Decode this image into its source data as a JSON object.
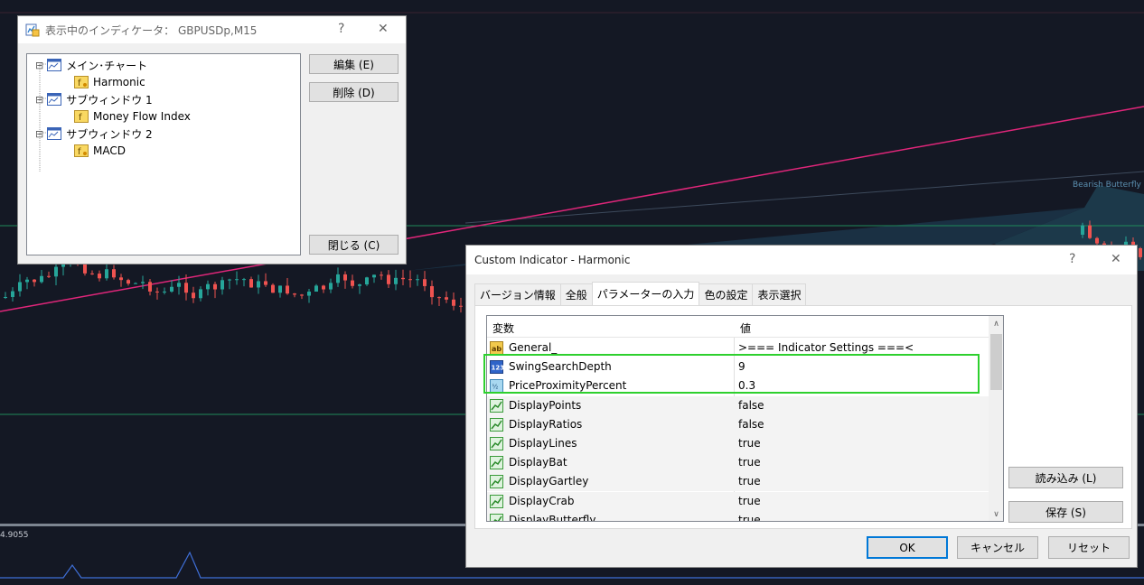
{
  "chart": {
    "price_label": "4.9055",
    "annotation": "Bearish Butterfly",
    "colors": {
      "background": "#141824",
      "bull_candle": "#26a69a",
      "bear_candle": "#ef5350",
      "trendline": "#e0267a",
      "hline": "#1f8a5a"
    }
  },
  "indicators_window": {
    "title": "表示中のインディケータ：  GBPUSDp,M15",
    "help_glyph": "?",
    "close_glyph": "✕",
    "tree": [
      {
        "label": "メイン･チャート",
        "icon": "window-chart-icon",
        "level": 0,
        "expander": "⊟"
      },
      {
        "label": "Harmonic",
        "icon": "custom-indicator-icon",
        "level": 1
      },
      {
        "label": "サブウィンドウ 1",
        "icon": "window-chart-icon",
        "level": 0,
        "expander": "⊟"
      },
      {
        "label": "Money Flow Index",
        "icon": "indicator-icon",
        "level": 1
      },
      {
        "label": "サブウィンドウ 2",
        "icon": "window-chart-icon",
        "level": 0,
        "expander": "⊟"
      },
      {
        "label": "MACD",
        "icon": "custom-indicator-icon",
        "level": 1
      }
    ],
    "edit_button": "編集 (E)",
    "delete_button": "削除 (D)",
    "close_button": "閉じる (C)"
  },
  "custom_indicator_dialog": {
    "title": "Custom Indicator - Harmonic",
    "help_glyph": "?",
    "close_glyph": "✕",
    "tabs": [
      {
        "label": "バージョン情報",
        "active": false
      },
      {
        "label": "全般",
        "active": false
      },
      {
        "label": "パラメーターの入力",
        "active": true
      },
      {
        "label": "色の設定",
        "active": false
      },
      {
        "label": "表示選択",
        "active": false
      }
    ],
    "columns": {
      "variable": "変数",
      "value": "値"
    },
    "params": [
      {
        "type_icon": "string-ab-icon",
        "name": "General_",
        "value": ">=== Indicator Settings ===<"
      },
      {
        "type_icon": "integer-icon",
        "name": "SwingSearchDepth",
        "value": "9"
      },
      {
        "type_icon": "double-icon",
        "name": "PriceProximityPercent",
        "value": "0.3"
      },
      {
        "type_icon": "bool-icon",
        "name": "DisplayPoints",
        "value": "false"
      },
      {
        "type_icon": "bool-icon",
        "name": "DisplayRatios",
        "value": "false"
      },
      {
        "type_icon": "bool-icon",
        "name": "DisplayLines",
        "value": "true"
      },
      {
        "type_icon": "bool-icon",
        "name": "DisplayBat",
        "value": "true"
      },
      {
        "type_icon": "bool-icon",
        "name": "DisplayGartley",
        "value": "true"
      },
      {
        "type_icon": "bool-icon",
        "name": "DisplayCrab",
        "value": "true"
      },
      {
        "type_icon": "bool-icon",
        "name": "DisplayButterfly",
        "value": "true"
      }
    ],
    "scroll_up": "∧",
    "scroll_down": "∨",
    "load_button": "読み込み (L)",
    "save_button": "保存 (S)",
    "ok_button": "OK",
    "cancel_button": "キャンセル",
    "reset_button": "リセット",
    "highlight_color": "#2ed02e"
  }
}
